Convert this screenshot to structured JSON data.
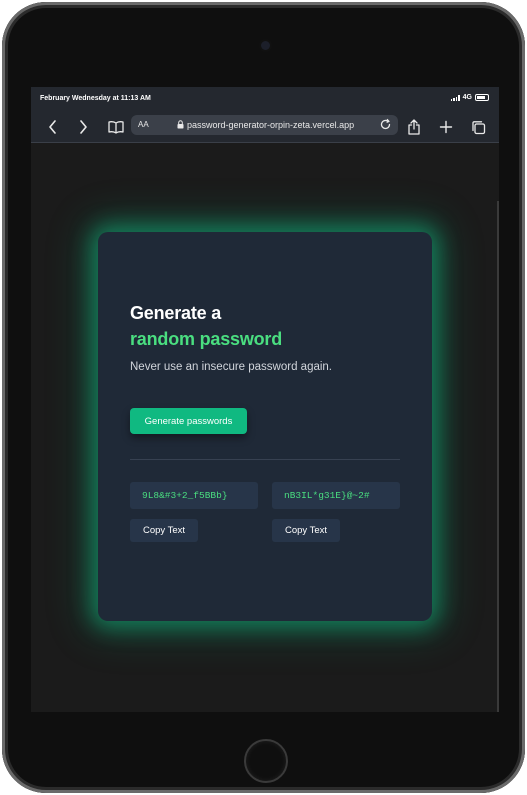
{
  "status_bar": {
    "time": "February Wednesday at 11:13 AM",
    "network": "4G"
  },
  "browser": {
    "text_size_label": "AA",
    "url": "password-generator-orpin-zeta.vercel.app"
  },
  "card": {
    "title_line1": "Generate a",
    "title_line2": "random password",
    "subtitle": "Never use an insecure password again.",
    "generate_label": "Generate passwords",
    "passwords": [
      "9L8&#3+2_f5BBb}",
      "nB3IL*g31E}@~2#"
    ],
    "copy_label": "Copy Text"
  },
  "colors": {
    "accent": "#10b981",
    "accent_text": "#4ade80",
    "card_bg": "#1f2937",
    "field_bg": "#273549"
  }
}
